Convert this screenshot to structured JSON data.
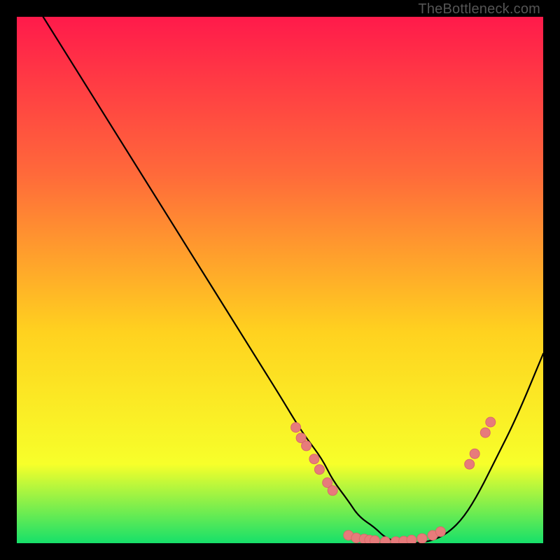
{
  "watermark": "TheBottleneck.com",
  "colors": {
    "gradient_top": "#ff1a4b",
    "gradient_mid1": "#ff6a3a",
    "gradient_mid2": "#ffd21f",
    "gradient_mid3": "#f7ff2a",
    "gradient_bottom": "#16e06a",
    "curve": "#000000",
    "dot_fill": "#e77b7b",
    "dot_stroke": "#d86a6a"
  },
  "chart_data": {
    "type": "line",
    "title": "",
    "xlabel": "",
    "ylabel": "",
    "xlim": [
      0,
      100
    ],
    "ylim": [
      0,
      100
    ],
    "x": [
      5,
      10,
      15,
      20,
      25,
      30,
      35,
      40,
      45,
      50,
      53,
      55,
      58,
      60,
      63,
      65,
      68,
      70,
      73,
      76,
      79,
      82,
      85,
      88,
      91,
      95,
      100
    ],
    "y": [
      100,
      92,
      84,
      76,
      68,
      60,
      52,
      44,
      36,
      28,
      23,
      20,
      16,
      12,
      8,
      5,
      3,
      1,
      0,
      0,
      0.5,
      2,
      5,
      10,
      16,
      24,
      36
    ],
    "dots": [
      {
        "x": 53,
        "y": 22
      },
      {
        "x": 54,
        "y": 20
      },
      {
        "x": 55,
        "y": 18.5
      },
      {
        "x": 56.5,
        "y": 16
      },
      {
        "x": 57.5,
        "y": 14
      },
      {
        "x": 59,
        "y": 11.5
      },
      {
        "x": 60,
        "y": 10
      },
      {
        "x": 63,
        "y": 1.5
      },
      {
        "x": 64.5,
        "y": 1
      },
      {
        "x": 66,
        "y": 0.8
      },
      {
        "x": 67,
        "y": 0.6
      },
      {
        "x": 68,
        "y": 0.5
      },
      {
        "x": 70,
        "y": 0.3
      },
      {
        "x": 72,
        "y": 0.3
      },
      {
        "x": 73.5,
        "y": 0.4
      },
      {
        "x": 75,
        "y": 0.6
      },
      {
        "x": 77,
        "y": 0.9
      },
      {
        "x": 79,
        "y": 1.5
      },
      {
        "x": 80.5,
        "y": 2.2
      },
      {
        "x": 86,
        "y": 15
      },
      {
        "x": 87,
        "y": 17
      },
      {
        "x": 89,
        "y": 21
      },
      {
        "x": 90,
        "y": 23
      }
    ]
  }
}
